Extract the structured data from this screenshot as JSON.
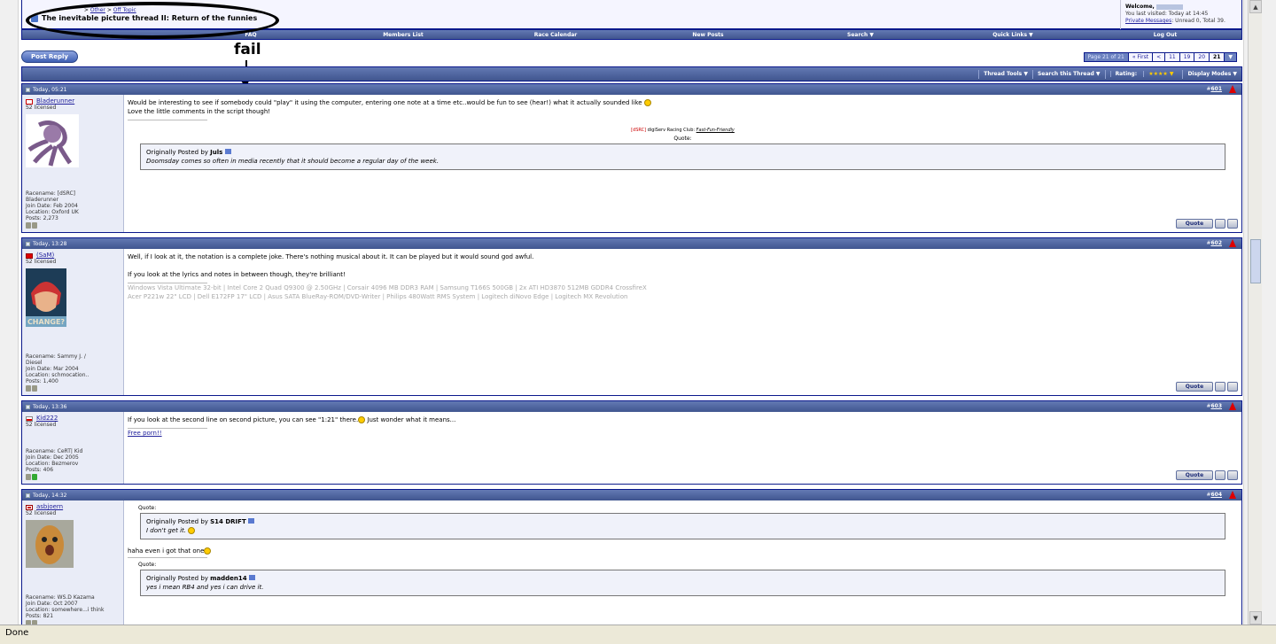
{
  "breadcrumb": {
    "items": [
      "Other",
      "Off Topic"
    ],
    "separator": ">"
  },
  "thread_title": "The inevitable picture thread II: Return of the funnies",
  "welcome": {
    "heading": "Welcome,",
    "last_visited": "You last visited: Today at 14:45",
    "private_messages_link": "Private Messages",
    "pm_status": ": Unread 0, Total 39."
  },
  "menu": [
    "FAQ",
    "Members List",
    "Race Calendar",
    "New Posts",
    "Search ▼",
    "Quick Links ▼",
    "Log Out"
  ],
  "post_reply_label": "Post Reply",
  "annotation": "fail",
  "pager": {
    "label": "Page 21 of 21",
    "first": "« First",
    "prev": "<",
    "p1": "11",
    "p2": "19",
    "p3": "20",
    "current": "21"
  },
  "thread_tools": {
    "tools": "Thread Tools ▼",
    "search": "Search this Thread ▼",
    "rating": "Rating:",
    "stars": "★★★★ ▼",
    "display": "Display Modes ▼"
  },
  "posts": [
    {
      "date": "Today, 05:21",
      "number": "601",
      "user": "Bladerunner",
      "rank": "S2 licensed",
      "racename": "Racename: [dSRC]",
      "racename2": "Bladerunner",
      "join": "Join Date: Feb 2004",
      "location": "Location: Oxford UK",
      "posts": "Posts: 2,273",
      "text1": "Would be interesting to see if somebody could \"play\" it using the computer, entering one note at a time etc..would be fun to see (hear!) what it actually sounded like",
      "text2": "Love the little comments in the script though!",
      "sig_tag": "[dSRC]",
      "sig_text": " digiServ Racing Club: ",
      "sig_motto": "Fast-Fun-Friendly",
      "quote_label": "Quote:",
      "quote_author_prefix": "Originally Posted by ",
      "quote_author": "Juls",
      "quote_text": "Doomsday comes so often in media recently that it should become a regular day of the week."
    },
    {
      "date": "Today, 13:28",
      "number": "602",
      "user": "(SaM)",
      "rank": "S2 licensed",
      "racename": "Racename: Sammy J. /",
      "racename2": "Diesel",
      "join": "Join Date: Mar 2004",
      "location": "Location: schmocation..",
      "posts": "Posts: 1,400",
      "text1": "Well, if I look at it, the notation is a complete joke. There's nothing musical about it. It can be played but it would sound god awful.",
      "text2": "If you look at the lyrics and notes in between though, they're brilliant!",
      "sig1": "Windows Vista Ultimate 32-bit | Intel Core 2 Quad Q9300 @ 2.50GHz | Corsair 4096 MB DDR3 RAM | Samsung T166S 500GB | 2x ATI HD3870 512MB GDDR4 CrossfireX",
      "sig2": "Acer P221w 22\" LCD | Dell E172FP 17\" LCD | Asus SATA BlueRay-ROM/DVD-Writer | Philips 480Watt RMS System | Logitech diNovo Edge | Logitech MX Revolution",
      "avatar_caption": "CHANGE?"
    },
    {
      "date": "Today, 13:36",
      "number": "603",
      "user": "Kid222",
      "rank": "S2 licensed",
      "racename": "Racename: CeRT| Kid",
      "join": "Join Date: Dec 2005",
      "location": "Location: Bezmerov",
      "posts": "Posts: 406",
      "text1": "If you look at the second line on second picture, you can see \"1:21\" there.",
      "text1b": " Just wonder what it means...",
      "sig_link": "Free porn!!"
    },
    {
      "date": "Today, 14:32",
      "number": "604",
      "user": "asbjoern",
      "rank": "S2 licensed",
      "racename": "Racename: WS.D Kazama",
      "join": "Join Date: Oct 2007",
      "location": "Location: somewhere...i think",
      "posts": "Posts: 821",
      "quote_label": "Quote:",
      "quote_author_prefix": "Originally Posted by ",
      "quote_author": "S14 DRIFT",
      "quote_text": "I don't get it.",
      "text1": "haha even i got that one",
      "quote2_label": "Quote:",
      "quote2_author": "madden14",
      "quote2_text": "yes i mean RB4 and yes i can drive it."
    }
  ],
  "quote_button": "Quote",
  "status_text": "Done"
}
